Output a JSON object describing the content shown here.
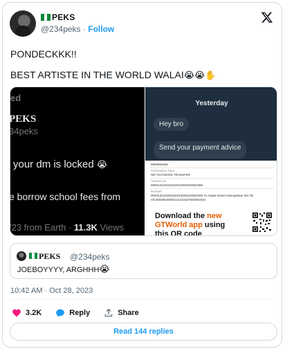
{
  "author": {
    "display_name": "PEKS",
    "handle": "@234peks",
    "separator": "·",
    "follow_label": "Follow"
  },
  "tweet": {
    "line1": "PONDECKKK!!",
    "line2": "BEST ARTISTE IN THE WORLD WALAI",
    "line2_emojis": "😭😭✋"
  },
  "media": {
    "left_panel": {
      "fragment_top": "ed",
      "name": "PEKS",
      "handle": "34peks",
      "dm_text": "your dm is locked",
      "dm_emoji": "😭",
      "fees_text": "e borrow school fees from",
      "meta_prefix": "/23 from Earth · ",
      "views": "11.3K",
      "views_label": " Views"
    },
    "right_panel": {
      "chat_day": "Yesterday",
      "bubble1": "Hey bro",
      "bubble2": "Send your payment advice",
      "receipt_lines": [
        "0050954060",
        "Transaction Type",
        "NIP OUTWARD TRANSFER",
        "Session ID",
        "000013231028102510000220553490",
        "Remark",
        "000013231028102510000220553490 To Arijate Daniel Oluropekan /53.75/ ref:30509540000131223157000002023"
      ],
      "download_line1": "Download the",
      "download_highlight": "new",
      "download_app": "GTWorld app",
      "download_line2_suffix": "using",
      "download_line3": "this QR code"
    }
  },
  "quoted_tweet": {
    "display_name": "PEKS",
    "handle": "@234peks",
    "text": "JOEBOYYYY, ARGHHH",
    "emoji": "😭"
  },
  "timestamp": "10:42 AM · Oct 28, 2023",
  "actions": {
    "likes": "3.2K",
    "reply_label": "Reply",
    "share_label": "Share"
  },
  "read_replies_label": "Read 144 replies",
  "colors": {
    "accent": "#1d9bf0",
    "like": "#f91880",
    "border": "#cfd9de",
    "muted": "#536471"
  },
  "icons": [
    "x-logo-icon",
    "heart-icon",
    "reply-icon",
    "share-icon",
    "nigeria-flag-icon",
    "qr-code-icon"
  ]
}
